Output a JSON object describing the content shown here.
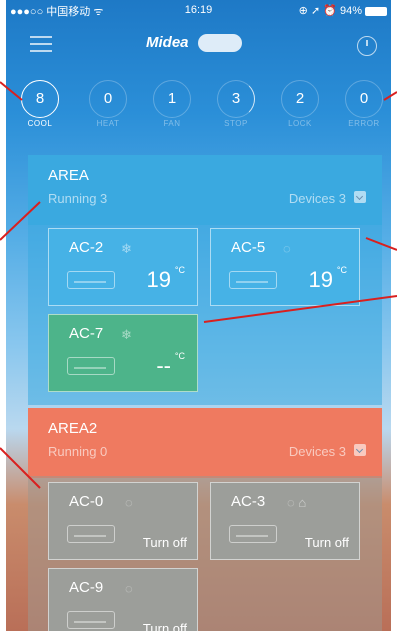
{
  "status_bar": {
    "carrier": "●●●○○ 中国移动 ᯤ",
    "time": "16:19",
    "right": "⊕ ➚ ⏰ 94%"
  },
  "header": {
    "logo_text": "Midea",
    "menu_icon": "hamburger-menu-icon",
    "clock_icon": "clock-icon"
  },
  "counters": [
    {
      "value": "8",
      "label": "COOL"
    },
    {
      "value": "0",
      "label": "HEAT"
    },
    {
      "value": "1",
      "label": "FAN"
    },
    {
      "value": "3",
      "label": "STOP"
    },
    {
      "value": "2",
      "label": "LOCK"
    },
    {
      "value": "0",
      "label": "ERROR"
    }
  ],
  "areas": [
    {
      "name": "AREA",
      "status": "Running 3",
      "devices": "Devices 3",
      "header_color": "#3aa9e0",
      "cards": [
        {
          "name": "AC-2",
          "icon": "❄",
          "temp": "19",
          "unit": "°C",
          "color": "#46b2e6"
        },
        {
          "name": "AC-5",
          "icon": "◌",
          "temp": "19",
          "unit": "°C",
          "color": "#46b2e6"
        },
        {
          "name": "AC-7",
          "icon": "❄",
          "temp": "--",
          "unit": "°C",
          "color": "#4db48a"
        }
      ]
    },
    {
      "name": "AREA2",
      "status": "Running 0",
      "devices": "Devices 3",
      "header_color": "#ef7a60",
      "cards": [
        {
          "name": "AC-0",
          "icon": "◌",
          "off_text": "Turn off",
          "color": "#9c9e9a"
        },
        {
          "name": "AC-3",
          "icon": "◌ ⌂",
          "off_text": "Turn off",
          "color": "#9c9e9a"
        },
        {
          "name": "AC-9",
          "icon": "◌",
          "off_text": "Turn off",
          "color": "#9c9e9a"
        }
      ]
    }
  ],
  "annotation_color": "#d9201f"
}
